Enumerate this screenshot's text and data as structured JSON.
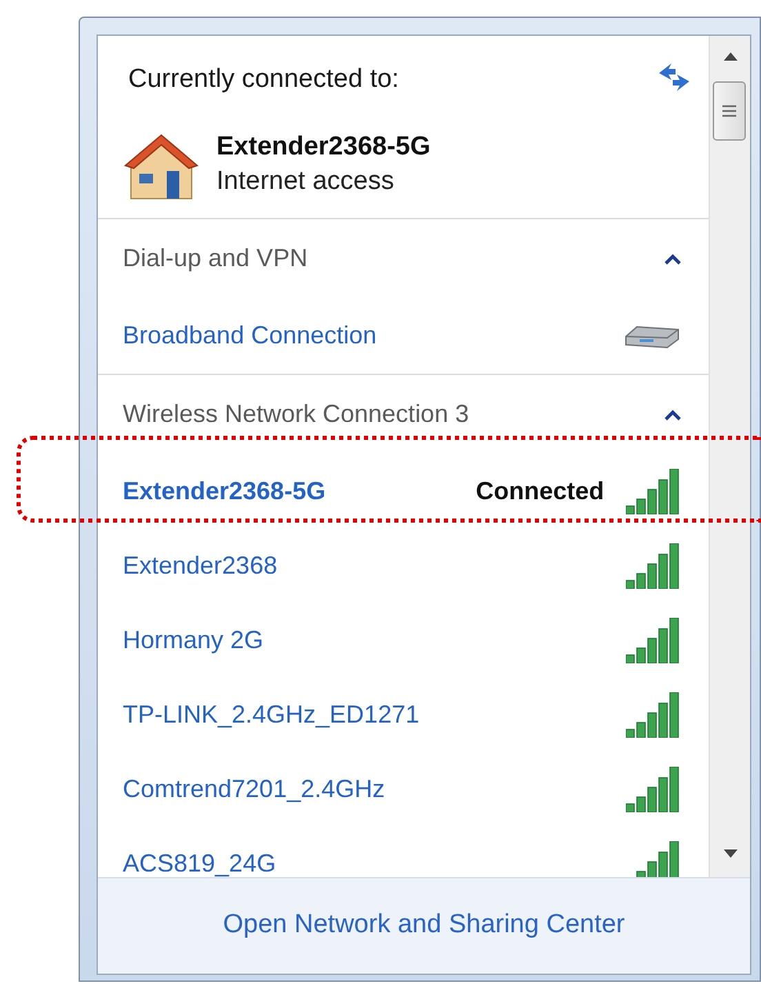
{
  "header": {
    "title": "Currently connected to:"
  },
  "current": {
    "name": "Extender2368-5G",
    "status": "Internet access"
  },
  "sections": [
    {
      "title": "Dial-up and VPN",
      "expanded": true,
      "items": [
        {
          "name": "Broadband Connection",
          "kind": "wired",
          "connected": false
        }
      ]
    },
    {
      "title": "Wireless Network Connection 3",
      "expanded": true,
      "items": [
        {
          "name": "Extender2368-5G",
          "kind": "wireless",
          "connected": true,
          "status": "Connected"
        },
        {
          "name": "Extender2368",
          "kind": "wireless",
          "connected": false
        },
        {
          "name": "Hormany 2G",
          "kind": "wireless",
          "connected": false
        },
        {
          "name": "TP-LINK_2.4GHz_ED1271",
          "kind": "wireless",
          "connected": false
        },
        {
          "name": "Comtrend7201_2.4GHz",
          "kind": "wireless",
          "connected": false
        },
        {
          "name": "ACS819_24G",
          "kind": "wireless",
          "connected": false
        }
      ]
    }
  ],
  "footer": {
    "link": "Open Network and Sharing Center"
  }
}
